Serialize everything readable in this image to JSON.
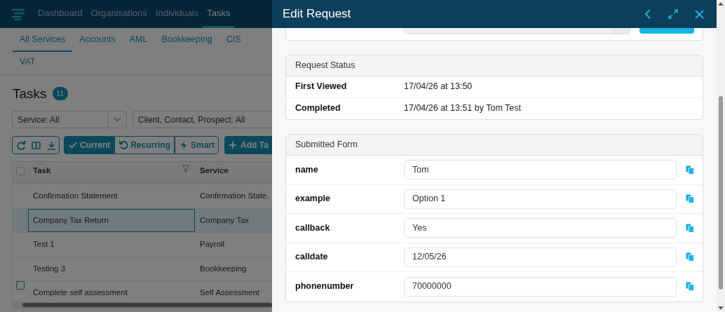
{
  "nav": {
    "items": [
      {
        "label": "Dashboard",
        "selected": false
      },
      {
        "label": "Organisations",
        "selected": false
      },
      {
        "label": "Individuals",
        "selected": false
      },
      {
        "label": "Tasks",
        "selected": true
      }
    ]
  },
  "service_tabs": [
    {
      "label": "All Services",
      "selected": true
    },
    {
      "label": "Accounts",
      "selected": false
    },
    {
      "label": "AML",
      "selected": false
    },
    {
      "label": "Bookkeeping",
      "selected": false
    },
    {
      "label": "CIS",
      "selected": false
    },
    {
      "label": "VAT",
      "selected": false
    }
  ],
  "page_title": "Tasks",
  "task_count": "11",
  "filters": [
    {
      "kind": "select",
      "value": "Service: All"
    },
    {
      "kind": "field",
      "value": "Client, Contact, Prospect: All"
    }
  ],
  "view_modes": [
    {
      "label": "Current",
      "selected": true
    },
    {
      "label": "Recurring",
      "selected": false
    },
    {
      "label": "Smart",
      "selected": false
    }
  ],
  "add_button": "Add Ta",
  "table": {
    "columns": [
      "Task",
      "Service"
    ],
    "rows": [
      {
        "task": "Confirmation Statement",
        "service": "Confirmation State.",
        "selected": false,
        "checkbox": false
      },
      {
        "task": "Company Tax Return",
        "service": "Company Tax",
        "selected": true,
        "checkbox": false
      },
      {
        "task": "Test 1",
        "service": "Payroll",
        "selected": false,
        "checkbox": false
      },
      {
        "task": "Testing 3",
        "service": "Bookkeeping",
        "selected": false,
        "checkbox": false
      },
      {
        "task": "Complete self assessment",
        "service": "Self Assessment",
        "selected": false,
        "checkbox": true
      }
    ]
  },
  "drawer": {
    "title": "Edit Request",
    "form_row": {
      "kind": "covered"
    },
    "status": {
      "title": "Request Status",
      "rows": [
        {
          "label": "First Viewed",
          "value": "17/04/26 at 13:50"
        },
        {
          "label": "Completed",
          "value": "17/04/26 at 13:51 by Tom Test"
        }
      ]
    },
    "submitted": {
      "title": "Submitted Form",
      "fields": [
        {
          "label": "name",
          "value": "Tom"
        },
        {
          "label": "example",
          "value": "Option 1"
        },
        {
          "label": "callback",
          "value": "Yes"
        },
        {
          "label": "calldate",
          "value": "12/05/26"
        },
        {
          "label": "phonenumber",
          "value": "70000000"
        }
      ]
    }
  }
}
